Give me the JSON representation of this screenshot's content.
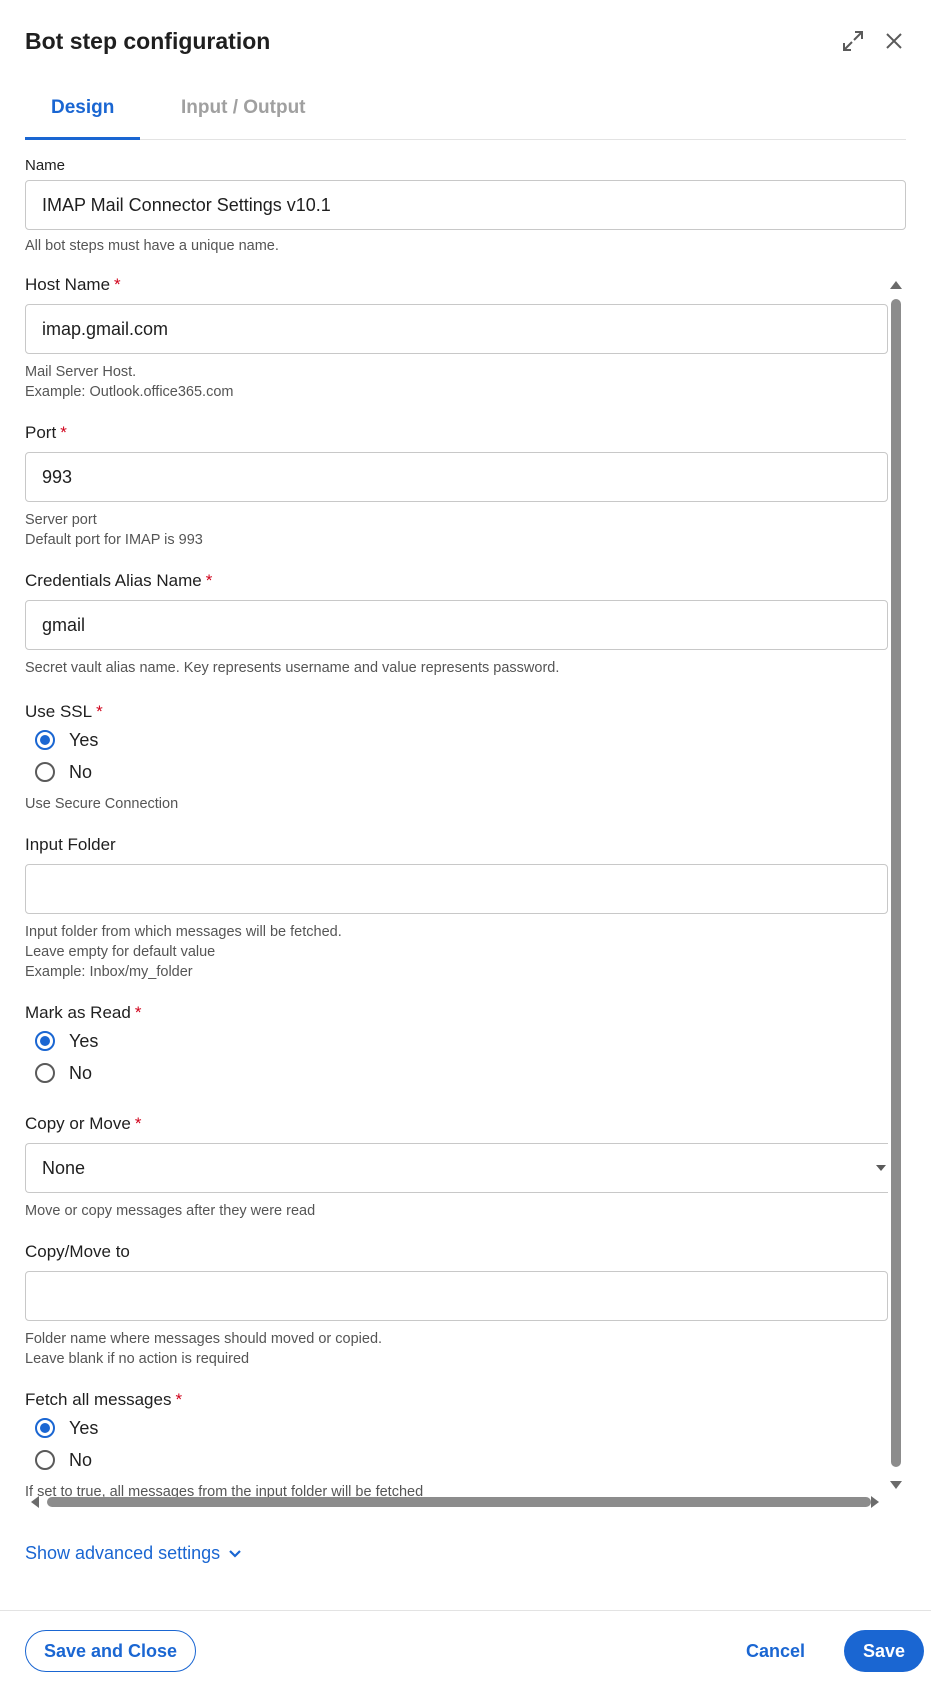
{
  "dialog": {
    "title": "Bot step configuration",
    "expand_icon": "expand-icon",
    "close_icon": "close-icon"
  },
  "tabs": [
    {
      "label": "Design",
      "active": true
    },
    {
      "label": "Input / Output",
      "active": false
    }
  ],
  "name_field": {
    "label": "Name",
    "value": "IMAP Mail Connector Settings v10.1",
    "help": "All bot steps must have a unique name."
  },
  "fields": {
    "host": {
      "label": "Host Name",
      "required": "*",
      "value": "imap.gmail.com",
      "help1": "Mail Server Host.",
      "help2": "Example: Outlook.office365.com"
    },
    "port": {
      "label": "Port",
      "required": "*",
      "value": "993",
      "help1": "Server port",
      "help2": "Default port for IMAP is 993"
    },
    "credentials": {
      "label": "Credentials Alias Name",
      "required": "*",
      "value": "gmail",
      "help1": "Secret vault alias name. Key represents username and value represents password."
    },
    "ssl": {
      "label": "Use SSL",
      "required": "*",
      "options": [
        "Yes",
        "No"
      ],
      "selected": "Yes",
      "help1": "Use Secure Connection"
    },
    "input_folder": {
      "label": "Input Folder",
      "value": "",
      "help1": "Input folder from which messages will be fetched.",
      "help2": "Leave empty for default value",
      "help3": "Example: Inbox/my_folder"
    },
    "mark_read": {
      "label": "Mark as Read",
      "required": "*",
      "options": [
        "Yes",
        "No"
      ],
      "selected": "Yes"
    },
    "copy_move": {
      "label": "Copy or Move",
      "required": "*",
      "value": "None",
      "help1": "Move or copy messages after they were read"
    },
    "copy_move_to": {
      "label": "Copy/Move to",
      "value": "",
      "help1": "Folder name where messages should moved or copied.",
      "help2": "Leave blank if no action is required"
    },
    "fetch_all": {
      "label": "Fetch all messages",
      "required": "*",
      "options": [
        "Yes",
        "No"
      ],
      "selected": "Yes",
      "help1": "If set to true, all messages from the input folder will be fetched"
    }
  },
  "advanced": {
    "label": "Show advanced settings",
    "icon": "chevron-down-icon"
  },
  "footer": {
    "save_close": "Save and Close",
    "cancel": "Cancel",
    "save": "Save"
  },
  "colors": {
    "accent": "#1a66d2",
    "required": "#d0021b"
  }
}
